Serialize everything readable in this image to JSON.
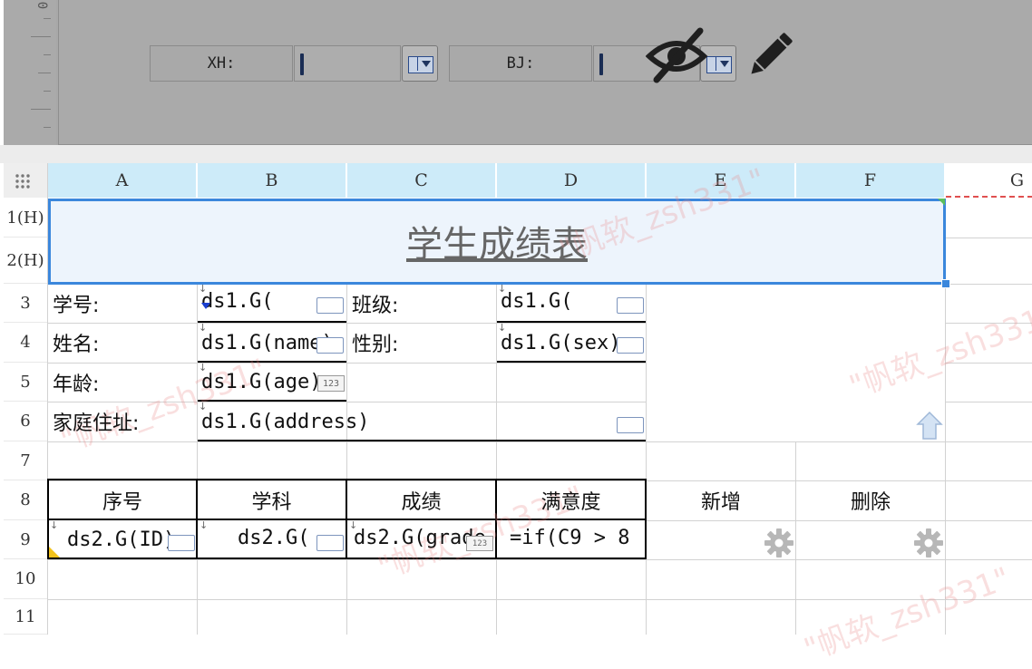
{
  "parameter_panel": {
    "ruler_zero": "0",
    "xh_label": "XH:",
    "bj_label": "BJ:"
  },
  "columns": [
    "A",
    "B",
    "C",
    "D",
    "E",
    "F",
    "G"
  ],
  "rows": [
    "1(H)",
    "2(H)",
    "3",
    "4",
    "5",
    "6",
    "7",
    "8",
    "9",
    "10",
    "11"
  ],
  "report": {
    "title": "学生成绩表",
    "student_id_label": "学号:",
    "student_id_value": "ds1.G(",
    "class_label": "班级:",
    "class_value": "ds1.G(",
    "name_label": "姓名:",
    "name_value": "ds1.G(name)",
    "sex_label": "性别:",
    "sex_value": "ds1.G(sex)",
    "age_label": "年龄:",
    "age_value": "ds1.G(age)",
    "address_label": "家庭住址:",
    "address_value": "ds1.G(address)"
  },
  "table": {
    "headers": [
      "序号",
      "学科",
      "成绩",
      "满意度",
      "新增",
      "删除"
    ],
    "row9": [
      "ds2.G(ID)",
      "ds2.G(",
      "ds2.G(grade",
      "=if(C9 > 8"
    ]
  },
  "watermark": {
    "text": "\"帆软_zsh331\""
  },
  "colors": {
    "selection": "#3b87dc",
    "column_header": "#cdebf9",
    "panel": "#aaaaaa"
  },
  "icons": [
    "hide-icon",
    "edit-icon",
    "gear-icon",
    "upload-arrow-icon",
    "dropdown-icon"
  ]
}
